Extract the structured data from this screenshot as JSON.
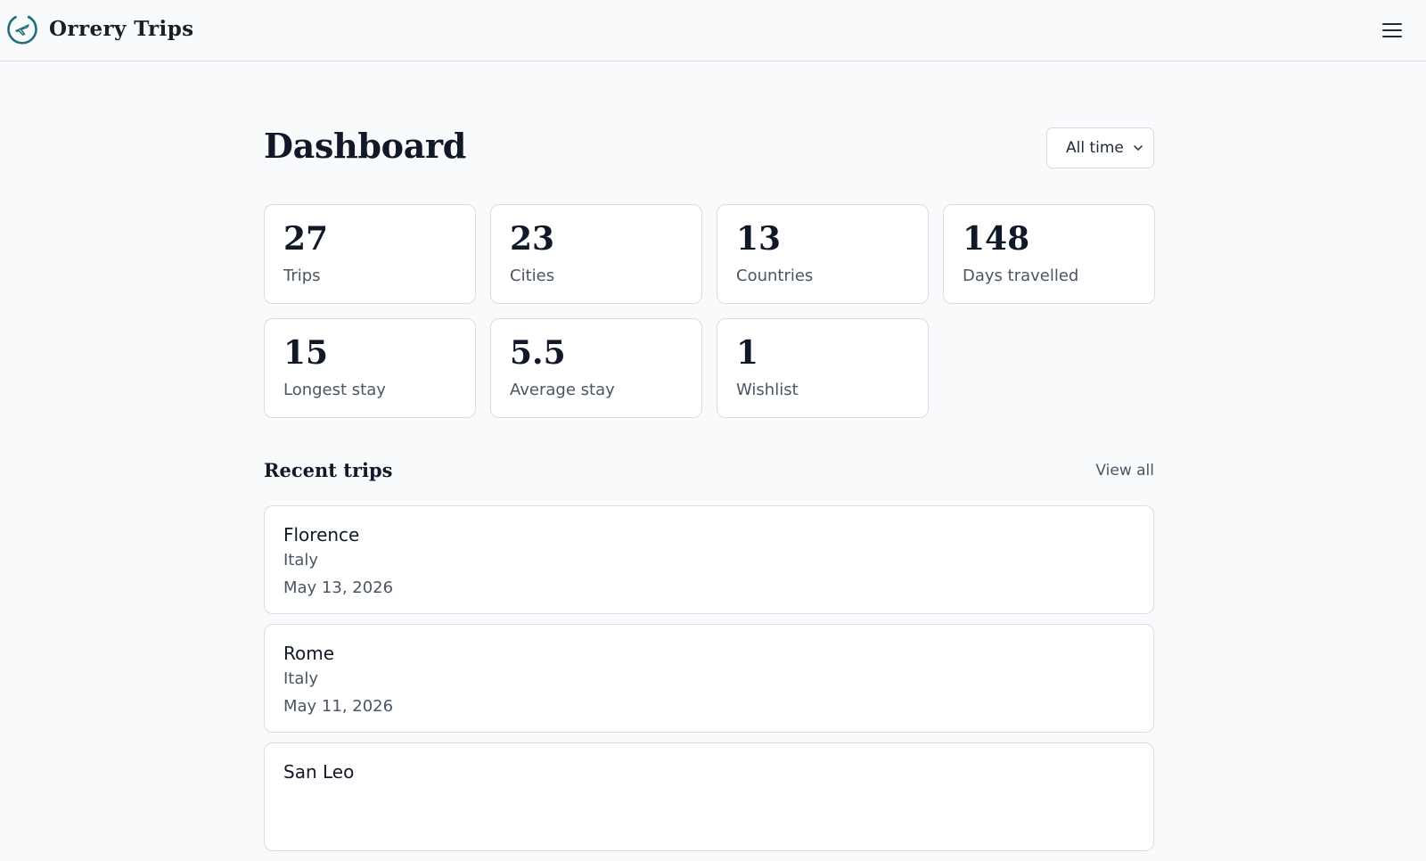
{
  "app": {
    "brand_name": "Orrery Trips",
    "logo_icon": "orbit-plane-icon",
    "menu_icon": "hamburger-menu-icon",
    "accent_color": "#1f6f78"
  },
  "dashboard": {
    "title": "Dashboard",
    "range_filter": {
      "selected": "All time",
      "icon": "chevron-down-icon"
    }
  },
  "stats": [
    {
      "value": "27",
      "label": "Trips"
    },
    {
      "value": "23",
      "label": "Cities"
    },
    {
      "value": "13",
      "label": "Countries"
    },
    {
      "value": "148",
      "label": "Days travelled"
    },
    {
      "value": "15",
      "label": "Longest stay"
    },
    {
      "value": "5.5",
      "label": "Average stay"
    },
    {
      "value": "1",
      "label": "Wishlist"
    }
  ],
  "recent_trips": {
    "title": "Recent trips",
    "view_all_label": "View all",
    "items": [
      {
        "city": "Florence",
        "country": "Italy",
        "date": "May 13, 2026"
      },
      {
        "city": "Rome",
        "country": "Italy",
        "date": "May 11, 2026"
      },
      {
        "city": "San Leo",
        "country": "",
        "date": ""
      }
    ]
  }
}
